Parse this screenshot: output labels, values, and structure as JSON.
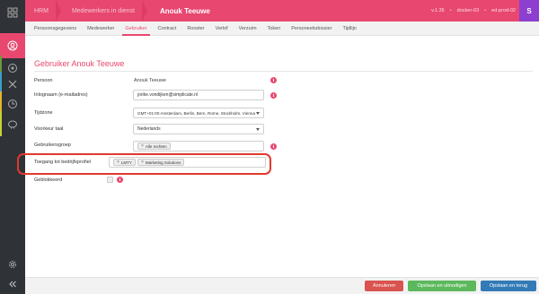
{
  "topbar": {
    "breadcrumbs": [
      "HRM",
      "Medewerkers in dienst",
      "Anouk Teeuwe"
    ],
    "version": "v.1.35",
    "server1": "docker-03",
    "server2": "ed-prod-02",
    "user_initial": "S"
  },
  "tabs": [
    "Persoonsgegevens",
    "Medewerker",
    "Gebruiker",
    "Contract",
    "Rooster",
    "Verlof",
    "Verzuim",
    "Token",
    "Personeelsdossier",
    "Tijdlijn"
  ],
  "active_tab": "Gebruiker",
  "page": {
    "title": "Gebruiker Anouk Teeuwe"
  },
  "form": {
    "persoon": {
      "label": "Persoon",
      "value": "Anouk Teeuwe"
    },
    "inlognaam": {
      "label": "Inlognaam (e-mailadres)",
      "value": "jorike.vondijken@simplicate.nl"
    },
    "tijdzone": {
      "label": "Tijdzone",
      "value": "GMT+01:00 Amsterdam, Berlin, Bern, Rome, Stockholm, Vienna"
    },
    "voorkeur_taal": {
      "label": "Voorkeur taal",
      "value": "Nederlands"
    },
    "gebruikersgroep": {
      "label": "Gebruikersgroep",
      "tags": [
        "Alle rechten"
      ]
    },
    "toegang": {
      "label": "Toegang tot bedrijfsprofiel",
      "tags": [
        "LMTY",
        "Marketing Solutions"
      ]
    },
    "geblokkeerd": {
      "label": "Geblokkeerd"
    }
  },
  "footer": {
    "cancel": "Annuleren",
    "save_invite": "Opslaan en uitnodigen",
    "save_back": "Opslaan en terug"
  },
  "colors": {
    "accent": "#e8476f",
    "sidebar": "#2f3237",
    "highlight": "#e0392f"
  },
  "sidebar_icons": [
    "dashboard-icon",
    "user-icon",
    "settings-icon",
    "tools-icon",
    "clock-icon",
    "piggybank-icon",
    "gear-icon",
    "collapse-icon"
  ]
}
